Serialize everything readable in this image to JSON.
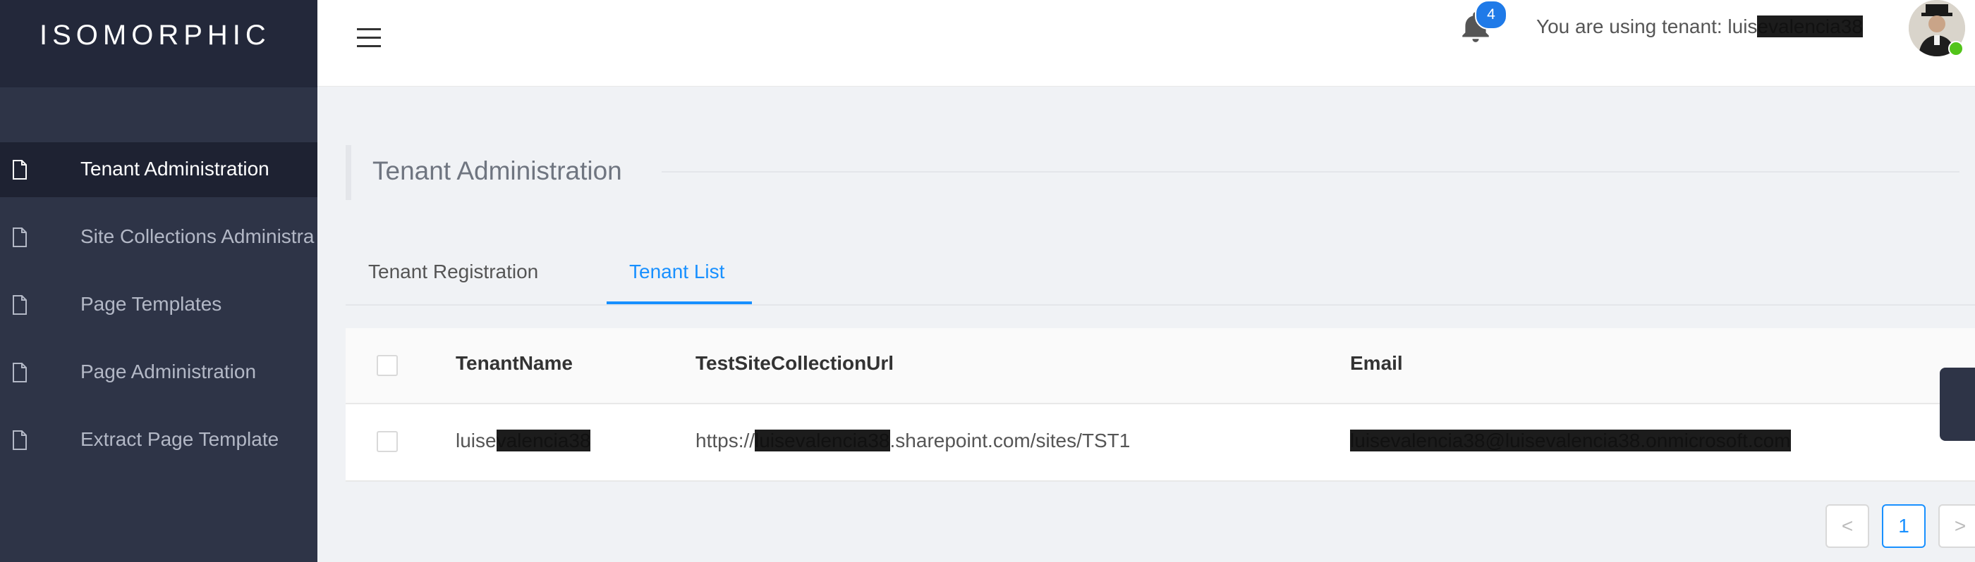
{
  "app": {
    "logo": "ISOMORPHIC"
  },
  "sidebar": {
    "items": [
      {
        "label": "Tenant Administration",
        "active": true,
        "icon": "file-icon"
      },
      {
        "label": "Site Collections Administra",
        "active": false,
        "icon": "file-icon"
      },
      {
        "label": "Page Templates",
        "active": false,
        "icon": "file-icon"
      },
      {
        "label": "Page Administration",
        "active": false,
        "icon": "file-icon"
      },
      {
        "label": "Extract Page Template",
        "active": false,
        "icon": "file-icon"
      }
    ]
  },
  "header": {
    "notification_count": "4",
    "tenant_prefix": "You are using tenant: luis",
    "tenant_redacted": "evalencia38"
  },
  "page": {
    "title": "Tenant Administration"
  },
  "tabs": [
    {
      "label": "Tenant Registration",
      "active": false
    },
    {
      "label": "Tenant List",
      "active": true
    }
  ],
  "table": {
    "columns": [
      "TenantName",
      "TestSiteCollectionUrl",
      "Email"
    ],
    "rows": [
      {
        "tenant_prefix": "luise",
        "tenant_redacted": "valencia38",
        "url_prefix": "https://",
        "url_redacted": "luisevalencia38",
        "url_suffix": ".sharepoint.com/sites/TST1",
        "email_redacted": "luisevalencia38@luisevalencia38.onmicrosoft.com"
      }
    ]
  },
  "pagination": {
    "prev": "<",
    "current": "1",
    "next": ">"
  },
  "colors": {
    "accent": "#1890ff",
    "sidebar": "#2e3447",
    "badge": "#1f7ae8",
    "online": "#52c41a"
  }
}
